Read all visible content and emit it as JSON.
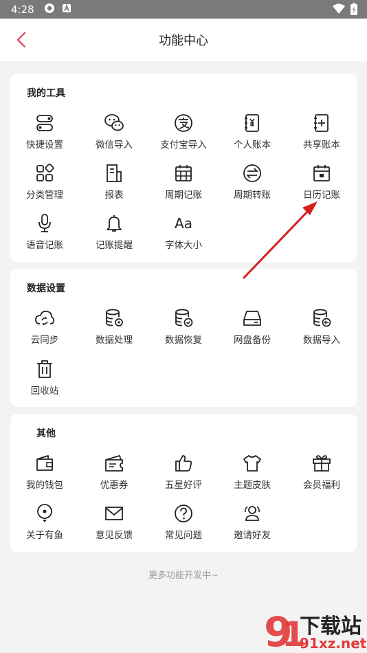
{
  "status_bar": {
    "time": "4:28"
  },
  "header": {
    "title": "功能中心"
  },
  "sections": [
    {
      "title": "我的工具",
      "items": [
        {
          "label": "快捷设置",
          "icon": "toggle-icon"
        },
        {
          "label": "微信导入",
          "icon": "wechat-icon"
        },
        {
          "label": "支付宝导入",
          "icon": "alipay-icon"
        },
        {
          "label": "个人账本",
          "icon": "personal-ledger-icon"
        },
        {
          "label": "共享账本",
          "icon": "shared-ledger-icon"
        },
        {
          "label": "分类管理",
          "icon": "category-icon"
        },
        {
          "label": "报表",
          "icon": "report-icon"
        },
        {
          "label": "周期记账",
          "icon": "calendar-grid-icon"
        },
        {
          "label": "周期转账",
          "icon": "transfer-icon"
        },
        {
          "label": "日历记账",
          "icon": "calendar-icon"
        },
        {
          "label": "语音记账",
          "icon": "microphone-icon"
        },
        {
          "label": "记账提醒",
          "icon": "bell-icon"
        },
        {
          "label": "字体大小",
          "icon": "font-size-icon"
        }
      ]
    },
    {
      "title": "数据设置",
      "items": [
        {
          "label": "云同步",
          "icon": "cloud-sync-icon"
        },
        {
          "label": "数据处理",
          "icon": "database-settings-icon"
        },
        {
          "label": "数据恢复",
          "icon": "database-check-icon"
        },
        {
          "label": "网盘备份",
          "icon": "hard-drive-icon"
        },
        {
          "label": "数据导入",
          "icon": "database-import-icon"
        },
        {
          "label": "回收站",
          "icon": "trash-icon"
        }
      ]
    },
    {
      "title": "其他",
      "items": [
        {
          "label": "我的钱包",
          "icon": "wallet-icon"
        },
        {
          "label": "优惠券",
          "icon": "coupon-icon"
        },
        {
          "label": "五星好评",
          "icon": "thumbs-up-icon"
        },
        {
          "label": "主题皮肤",
          "icon": "tshirt-icon"
        },
        {
          "label": "会员福利",
          "icon": "gift-icon"
        },
        {
          "label": "关于有鱼",
          "icon": "location-pin-icon"
        },
        {
          "label": "意见反馈",
          "icon": "mail-icon"
        },
        {
          "label": "常见问题",
          "icon": "help-icon"
        },
        {
          "label": "邀请好友",
          "icon": "invite-friends-icon"
        }
      ]
    }
  ],
  "footer_note": "更多功能开发中~",
  "watermark": {
    "brand": "下载站",
    "url": "91xz.net"
  },
  "colors": {
    "accent": "#e0394f",
    "arrow": "#d91c1c"
  }
}
